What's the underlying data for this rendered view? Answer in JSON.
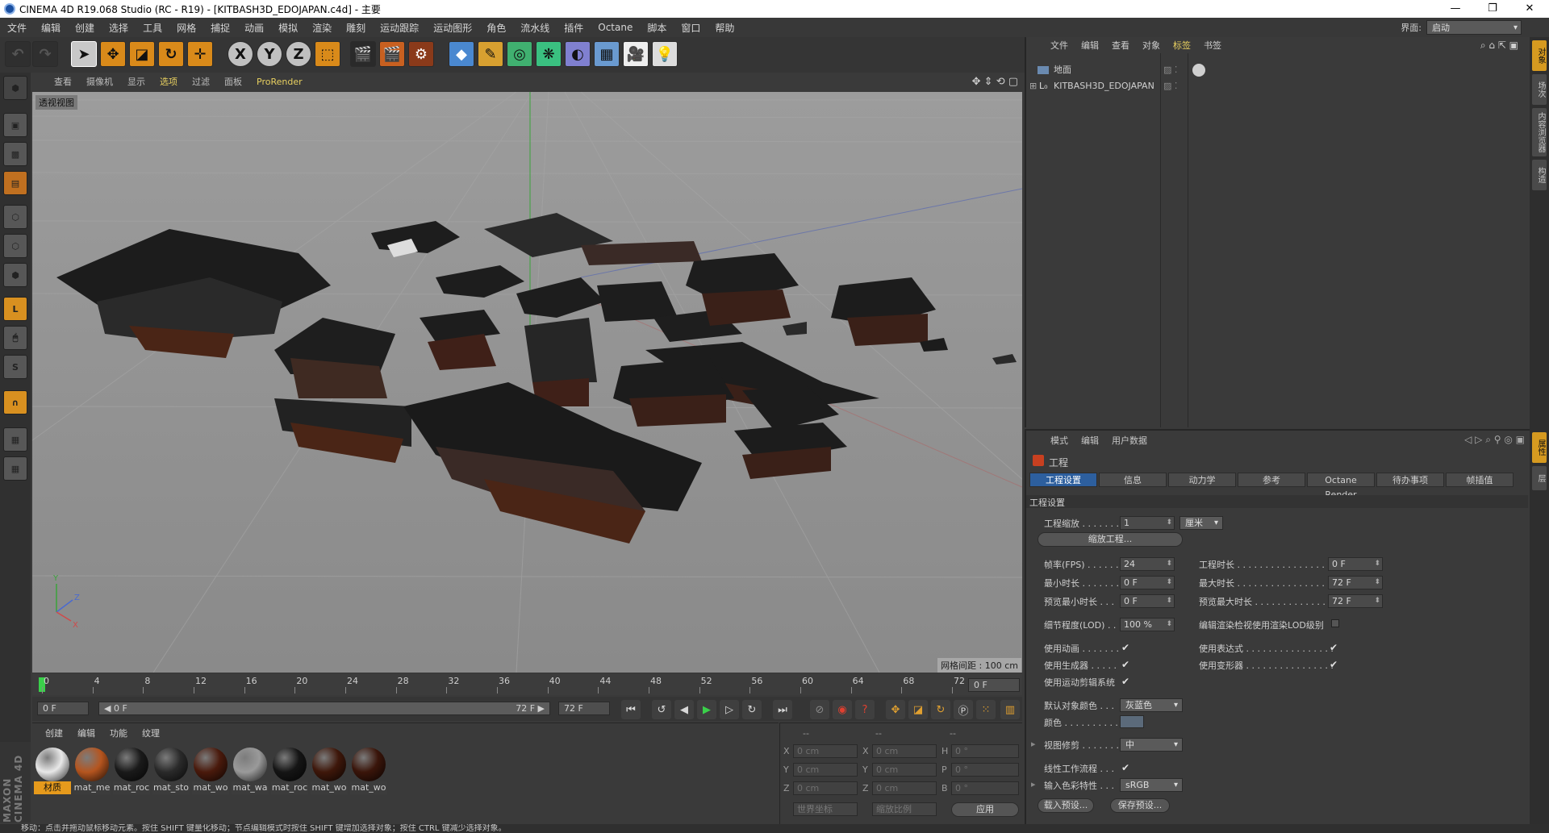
{
  "window": {
    "title": "CINEMA 4D R19.068 Studio (RC - R19) - [KITBASH3D_EDOJAPAN.c4d] - 主要",
    "minimize": "—",
    "restore": "❐",
    "close": "✕"
  },
  "menubar": {
    "items": [
      "文件",
      "编辑",
      "创建",
      "选择",
      "工具",
      "网格",
      "捕捉",
      "动画",
      "模拟",
      "渲染",
      "雕刻",
      "运动跟踪",
      "运动图形",
      "角色",
      "流水线",
      "插件",
      "Octane",
      "脚本",
      "窗口",
      "帮助"
    ],
    "layout_label": "界面:",
    "layout_value": "启动"
  },
  "toolbar": {
    "x_label": "X",
    "y_label": "Y",
    "z_label": "Z"
  },
  "viewport": {
    "menu": [
      "查看",
      "摄像机",
      "显示",
      "选项",
      "过滤",
      "面板",
      "ProRender"
    ],
    "label": "透视视图",
    "grid_spacing": "网格间距 : 100 cm",
    "axis_y": "Y",
    "axis_z": "Z",
    "axis_x": "X"
  },
  "timeline": {
    "ticks": [
      "0",
      "4",
      "8",
      "12",
      "16",
      "20",
      "24",
      "28",
      "32",
      "36",
      "40",
      "44",
      "48",
      "52",
      "56",
      "60",
      "64",
      "68",
      "72"
    ],
    "current_frame": "0 F",
    "start_field": "0 F",
    "range_start": "◀ 0 F",
    "range_end": "72 F ▶",
    "end_field": "72 F"
  },
  "materials": {
    "menu": [
      "创建",
      "编辑",
      "功能",
      "纹理"
    ],
    "items": [
      {
        "label": "材质",
        "color": "#e8e8e8"
      },
      {
        "label": "mat_me",
        "color": "#b5551f"
      },
      {
        "label": "mat_roc",
        "color": "#1a1a1a"
      },
      {
        "label": "mat_sto",
        "color": "#2a2a2a"
      },
      {
        "label": "mat_wo",
        "color": "#4a1a0c"
      },
      {
        "label": "mat_wa",
        "color": "#9a9a9a"
      },
      {
        "label": "mat_roc",
        "color": "#151515"
      },
      {
        "label": "mat_wo",
        "color": "#3e170a"
      },
      {
        "label": "mat_wo",
        "color": "#3a150a"
      }
    ]
  },
  "coords": {
    "header": [
      "--",
      "--",
      "--"
    ],
    "rows": [
      {
        "a": "X",
        "av": "0 cm",
        "b": "X",
        "bv": "0 cm",
        "c": "H",
        "cv": "0 °"
      },
      {
        "a": "Y",
        "av": "0 cm",
        "b": "Y",
        "bv": "0 cm",
        "c": "P",
        "cv": "0 °"
      },
      {
        "a": "Z",
        "av": "0 cm",
        "b": "Z",
        "bv": "0 cm",
        "c": "B",
        "cv": "0 °"
      }
    ],
    "world_coords": "世界坐标",
    "scale_ratio": "缩放比例",
    "apply": "应用"
  },
  "objects": {
    "menu": [
      "文件",
      "编辑",
      "查看",
      "对象",
      "标签",
      "书签"
    ],
    "items": [
      {
        "label": "地面"
      },
      {
        "label": "KITBASH3D_EDOJAPAN"
      }
    ]
  },
  "attributes": {
    "menu": [
      "模式",
      "编辑",
      "用户数据"
    ],
    "section_title": "工程",
    "tabs": [
      "工程设置",
      "信息",
      "动力学",
      "参考",
      "Octane Render",
      "待办事项",
      "帧插值"
    ],
    "group_title": "工程设置",
    "project_scale_label": "工程缩放 . . . . . . .",
    "project_scale_value": "1",
    "project_scale_unit": "厘米",
    "scale_project_button": "缩放工程...",
    "fps_label": "帧率(FPS) . . . . . . .",
    "fps_value": "24",
    "project_length_label": "工程时长 . . . . . . . . . . . . . . . . .",
    "project_length_value": "0 F",
    "min_time_label": "最小时长 . . . . . . .",
    "min_time_value": "0 F",
    "max_time_label": "最大时长 . . . . . . . . . . . . . . . . .",
    "max_time_value": "72 F",
    "preview_min_label": "预览最小时长 . . .",
    "preview_min_value": "0 F",
    "preview_max_label": "预览最大时长 . . . . . . . . . . . . . .",
    "preview_max_value": "72 F",
    "lod_label": "细节程度(LOD) . . .",
    "lod_value": "100 %",
    "render_lod_label": "编辑渲染检视使用渲染LOD级别",
    "use_animation_label": "使用动画 . . . . . . .",
    "use_expression_label": "使用表达式 . . . . . . . . . . . . . . . .",
    "use_generator_label": "使用生成器 . . . . .",
    "use_deformer_label": "使用变形器 . . . . . . . . . . . . . . . .",
    "use_motion_label": "使用运动剪辑系统",
    "default_color_label": "默认对象颜色 . . .",
    "default_color_value": "灰蓝色",
    "color_label": "颜色 . . . . . . . . . . .",
    "clipping_label": "视图修剪 . . . . . . .",
    "clipping_value": "中",
    "linear_workflow_label": "线性工作流程 . . .",
    "input_color_label": "输入色彩特性 . . .",
    "input_color_value": "sRGB",
    "load_preset": "载入预设...",
    "save_preset": "保存预设..."
  },
  "rightstrip": [
    "对象",
    "场次",
    "内容浏览器",
    "构造"
  ],
  "rightstrip_bottom": [
    "属性",
    "层"
  ],
  "status": "移动：点击并拖动鼠标移动元素。按住 SHIFT 键量化移动；节点编辑模式时按住 SHIFT 键增加选择对象；按住 CTRL 键减少选择对象。",
  "maxon": "MAXON CINEMA 4D"
}
